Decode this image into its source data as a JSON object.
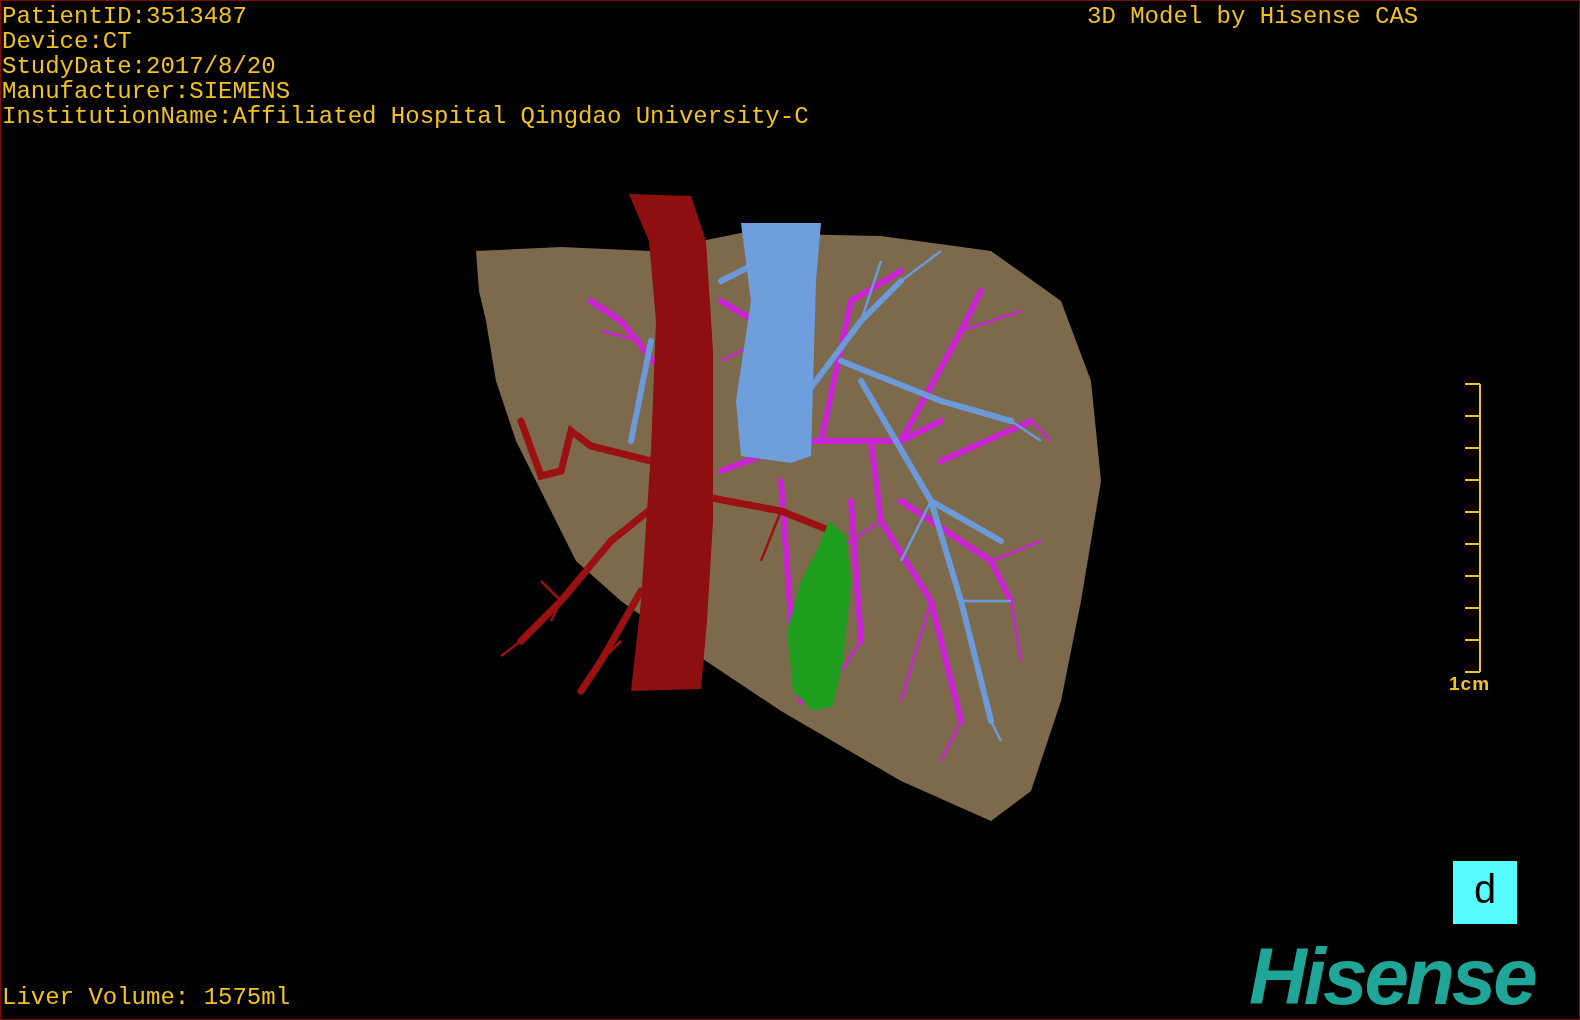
{
  "patient_info": [
    "PatientID:3513487",
    "Device:CT",
    "StudyDate:2017/8/20",
    "Manufacturer:SIEMENS",
    "InstitutionName:Affiliated Hospital Qingdao University-C"
  ],
  "title": "3D Model by Hisense CAS",
  "scale_bar": {
    "label": "1cm"
  },
  "view_button": {
    "label": "d"
  },
  "logo": {
    "text": "Hisense"
  },
  "liver_volume": "Liver Volume: 1575ml"
}
